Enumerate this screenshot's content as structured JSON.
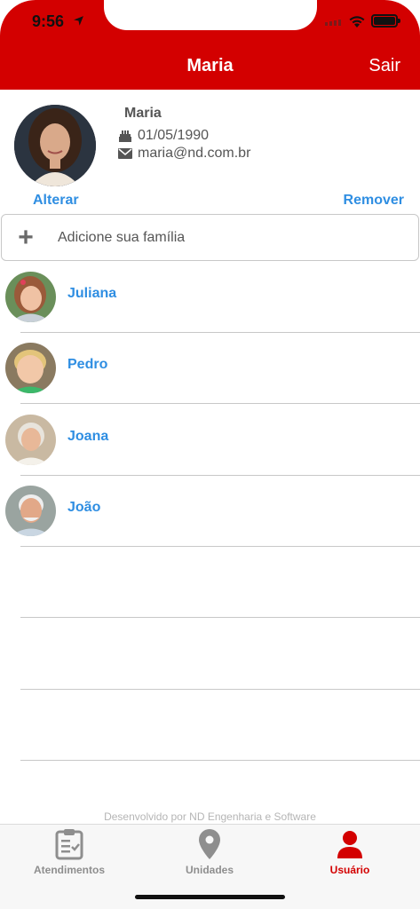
{
  "status_bar": {
    "time": "9:56"
  },
  "nav": {
    "title": "Maria",
    "logout_label": "Sair"
  },
  "profile": {
    "name": "Maria",
    "birth_date": "01/05/1990",
    "email": "maria@nd.com.br",
    "change_label": "Alterar",
    "remove_label": "Remover"
  },
  "add_family": {
    "label": "Adicione sua família"
  },
  "family": [
    {
      "name": "Juliana"
    },
    {
      "name": "Pedro"
    },
    {
      "name": "Joana"
    },
    {
      "name": "João"
    }
  ],
  "footer": {
    "credit": "Desenvolvido por ND Engenharia e Software"
  },
  "tabs": [
    {
      "label": "Atendimentos",
      "icon": "clipboard-icon"
    },
    {
      "label": "Unidades",
      "icon": "map-pin-icon"
    },
    {
      "label": "Usuário",
      "icon": "user-icon",
      "active": true
    }
  ],
  "colors": {
    "brand": "#d30000",
    "link": "#2f8ee2",
    "inactive_tab": "#8e8e8e"
  }
}
